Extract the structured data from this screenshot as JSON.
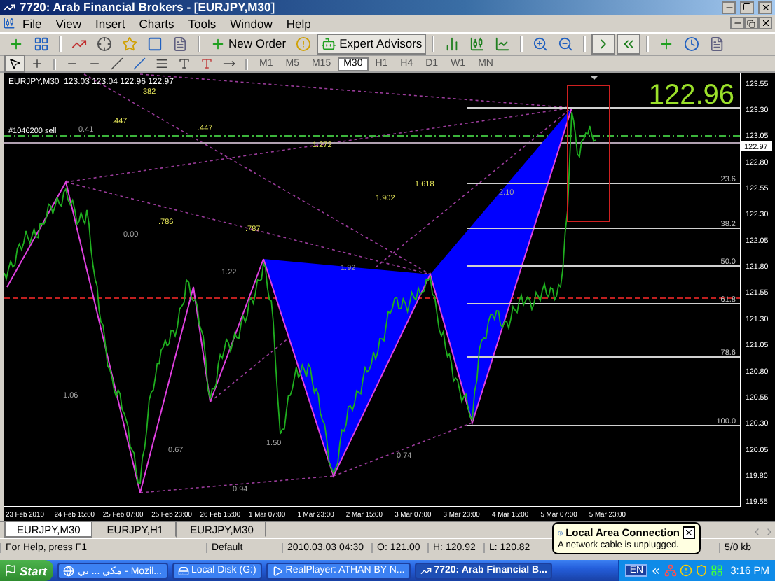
{
  "window": {
    "title": "7720: Arab Financial Brokers - [EURJPY,M30]"
  },
  "menu": [
    "File",
    "View",
    "Insert",
    "Charts",
    "Tools",
    "Window",
    "Help"
  ],
  "toolbar": {
    "new_order": "New Order",
    "expert_advisors": "Expert Advisors"
  },
  "timeframes": [
    {
      "label": "M1",
      "selected": false
    },
    {
      "label": "M5",
      "selected": false
    },
    {
      "label": "M15",
      "selected": false
    },
    {
      "label": "M30",
      "selected": true
    },
    {
      "label": "H1",
      "selected": false
    },
    {
      "label": "H4",
      "selected": false
    },
    {
      "label": "D1",
      "selected": false
    },
    {
      "label": "W1",
      "selected": false
    },
    {
      "label": "MN",
      "selected": false
    }
  ],
  "chart": {
    "header": "EURJPY,M30  123.03 123.04 122.96 122.97",
    "order_label": "#1046200 sell",
    "bid_display": "122.96",
    "current_price": "122.97",
    "pattern_labels": [
      {
        "text": "382",
        "kind": "fib"
      },
      {
        "text": ".447",
        "kind": "fib"
      },
      {
        "text": ".447",
        "kind": "fib"
      },
      {
        "text": "0.41",
        "kind": "ratio"
      },
      {
        "text": "1.272",
        "kind": "fib"
      },
      {
        "text": "1.618",
        "kind": "fib"
      },
      {
        "text": "2.10",
        "kind": "ratio"
      },
      {
        "text": "1.902",
        "kind": "fib"
      },
      {
        "text": ".786",
        "kind": "fib"
      },
      {
        "text": ".787",
        "kind": "fib"
      },
      {
        "text": "0.00",
        "kind": "ratio"
      },
      {
        "text": "1.92",
        "kind": "ratio"
      },
      {
        "text": "1.22",
        "kind": "ratio"
      },
      {
        "text": "1.06",
        "kind": "ratio"
      },
      {
        "text": "1.50",
        "kind": "ratio"
      },
      {
        "text": "0.67",
        "kind": "ratio"
      },
      {
        "text": "0.74",
        "kind": "ratio"
      },
      {
        "text": "0.94",
        "kind": "ratio"
      }
    ],
    "fib_levels": [
      "23.6",
      "38.2",
      "50.0",
      "61.8",
      "78.6",
      "100.0"
    ],
    "time_axis": [
      "23 Feb 2010",
      "24 Feb 15:00",
      "25 Feb 07:00",
      "25 Feb 23:00",
      "26 Feb 15:00",
      "1 Mar 07:00",
      "1 Mar 23:00",
      "2 Mar 15:00",
      "3 Mar 07:00",
      "3 Mar 23:00",
      "4 Mar 15:00",
      "5 Mar 07:00",
      "5 Mar 23:00"
    ],
    "price_axis": [
      "123.55",
      "123.30",
      "123.05",
      "122.80",
      "122.55",
      "122.30",
      "122.05",
      "121.80",
      "121.55",
      "121.30",
      "121.05",
      "120.80",
      "120.55",
      "120.30",
      "120.05",
      "119.80",
      "119.55"
    ]
  },
  "chart_tabs": [
    {
      "label": "EURJPY,M30",
      "selected": true
    },
    {
      "label": "EURJPY,H1",
      "selected": false
    },
    {
      "label": "EURJPY,M30",
      "selected": false
    }
  ],
  "status_bar": [
    "For Help, press F1",
    "Default",
    "2010.03.03 04:30",
    "O: 121.00",
    "H: 120.92",
    "L: 120.82",
    "5/0 kb"
  ],
  "notification": {
    "title": "Local Area Connection",
    "message": "A network cable is unplugged."
  },
  "taskbar": {
    "start": "Start",
    "tasks": [
      {
        "label": "مكي ... بي - Mozil...",
        "selected": false
      },
      {
        "label": "Local Disk (G:)",
        "selected": false
      },
      {
        "label": "RealPlayer: ATHAN BY N...",
        "selected": false
      },
      {
        "label": "7720: Arab Financial B...",
        "selected": true
      }
    ],
    "language": "EN",
    "clock": "3:16 PM"
  }
}
